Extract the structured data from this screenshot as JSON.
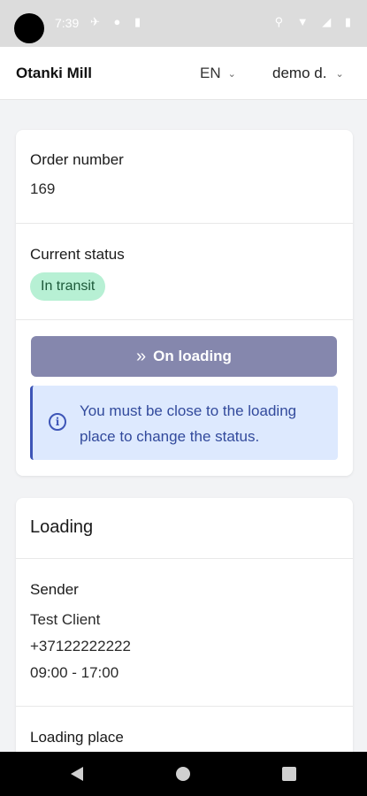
{
  "status_bar": {
    "time": "7:39",
    "left_icons": "✈ ● ▮",
    "right_icons": "⚲ ▼ ◢ ▮"
  },
  "header": {
    "title": "Otanki Mill",
    "language": "EN",
    "user": "demo d."
  },
  "order": {
    "number_label": "Order number",
    "number_value": "169",
    "status_label": "Current status",
    "status_value": "In transit",
    "status_color": "#b7f0d4",
    "action_icon": "»",
    "action_label": "On loading",
    "action_color": "#8587ad",
    "info_icon": "i",
    "info_text": "You must be close to the loading place to change the status.",
    "info_bg_color": "#dde9fe"
  },
  "loading": {
    "section_title": "Loading",
    "sender_label": "Sender",
    "sender_name": "Test Client",
    "sender_phone": "+37122222222",
    "sender_hours": "09:00 - 17:00",
    "place_label": "Loading place"
  }
}
